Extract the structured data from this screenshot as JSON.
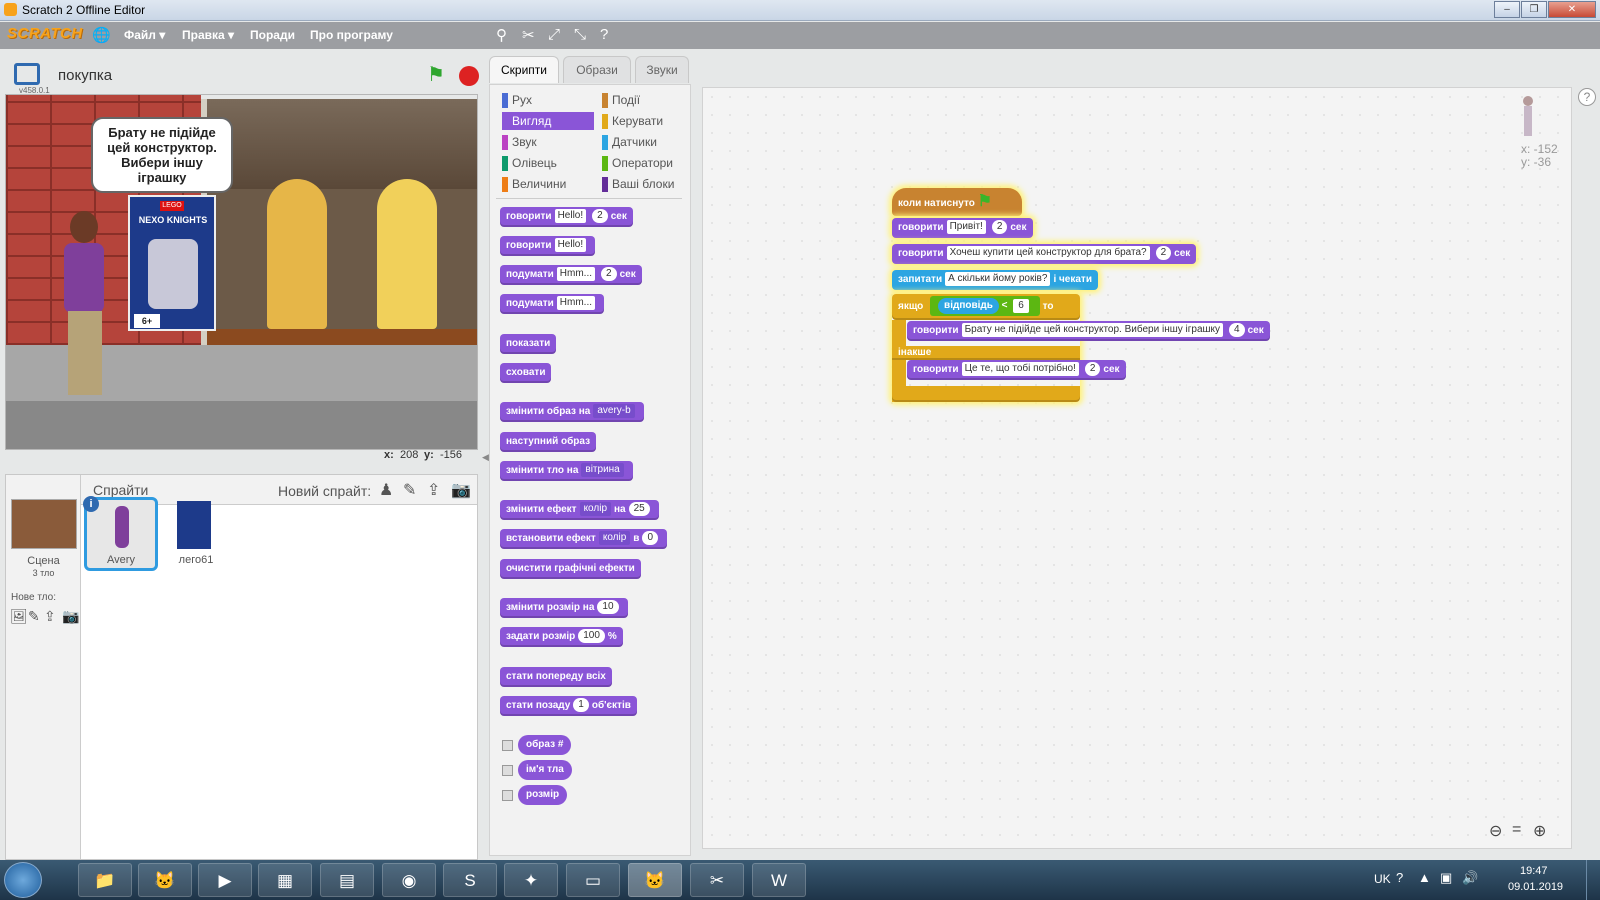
{
  "window": {
    "title": "Scratch 2 Offline Editor"
  },
  "menu": {
    "logo": "SCRATCH",
    "file": "Файл ▾",
    "edit": "Правка ▾",
    "tips": "Поради",
    "about": "Про програму"
  },
  "stage_header": {
    "project_name": "покупка",
    "version": "v458.0.1"
  },
  "stage": {
    "speech": "Брату не підійде цей конструктор. Вибери іншу іграшку",
    "box_brand": "LEGO",
    "box_title": "NEXO KNIGHTS",
    "box_age": "6+",
    "x_label": "x:",
    "x_value": "208",
    "y_label": "y:",
    "y_value": "-156"
  },
  "sprites_pane": {
    "title": "Спрайти",
    "new_sprite": "Новий спрайт:",
    "stage_label": "Сцена",
    "stage_backdrops": "3 тло",
    "new_backdrop": "Нове тло:",
    "sprites": [
      {
        "name": "Avery"
      },
      {
        "name": "лего61"
      }
    ]
  },
  "tabs": [
    "Скрипти",
    "Образи",
    "Звуки"
  ],
  "categories": [
    {
      "label": "Рух",
      "color": "#4a6cd4"
    },
    {
      "label": "Вигляд",
      "color": "#8a55d7"
    },
    {
      "label": "Звук",
      "color": "#bb42c3"
    },
    {
      "label": "Олівець",
      "color": "#0e9a6c"
    },
    {
      "label": "Величини",
      "color": "#ee7d16"
    },
    {
      "label": "Події",
      "color": "#c88330"
    },
    {
      "label": "Керувати",
      "color": "#e1a91a"
    },
    {
      "label": "Датчики",
      "color": "#2ca5e2"
    },
    {
      "label": "Оператори",
      "color": "#5cb712"
    },
    {
      "label": "Ваші блоки",
      "color": "#632d99"
    }
  ],
  "palette": {
    "say_secs": {
      "cmd": "говорити",
      "msg": "Hello!",
      "secs": "2",
      "unit": "сек"
    },
    "say": {
      "cmd": "говорити",
      "msg": "Hello!"
    },
    "think_secs": {
      "cmd": "подумати",
      "msg": "Hmm...",
      "secs": "2",
      "unit": "сек"
    },
    "think": {
      "cmd": "подумати",
      "msg": "Hmm..."
    },
    "show": "показати",
    "hide": "сховати",
    "switch_costume": {
      "cmd": "змінити образ на",
      "val": "avery-b"
    },
    "next_costume": "наступний образ",
    "switch_backdrop": {
      "cmd": "змінити тло на",
      "val": "вітрина"
    },
    "change_effect": {
      "cmd": "змінити ефект",
      "effect": "колір",
      "by": "на",
      "val": "25"
    },
    "set_effect": {
      "cmd": "встановити ефект",
      "effect": "колір",
      "to": "в",
      "val": "0"
    },
    "clear_effects": "очистити графічні ефекти",
    "change_size": {
      "cmd": "змінити розмір на",
      "val": "10"
    },
    "set_size": {
      "cmd": "задати розмір",
      "val": "100",
      "unit": "%"
    },
    "go_front": "стати попереду всіх",
    "go_back": {
      "cmd": "стати позаду",
      "val": "1",
      "unit": "об'єктів"
    },
    "reporters": [
      "образ #",
      "ім'я тла",
      "розмір"
    ]
  },
  "script": {
    "hat": "коли натиснуто",
    "say1": {
      "cmd": "говорити",
      "msg": "Привіт!",
      "secs": "2",
      "unit": "сек"
    },
    "say2": {
      "cmd": "говорити",
      "msg": "Хочеш купити цей конструктор для брата?",
      "secs": "2",
      "unit": "сек"
    },
    "ask": {
      "cmd": "запитати",
      "msg": "А скільки йому років?",
      "tail": "і чекати"
    },
    "if": {
      "kw": "якщо",
      "reporter": "відповідь",
      "op": "<",
      "val": "6",
      "then": "то"
    },
    "say3": {
      "cmd": "говорити",
      "msg": "Брату не підійде цей конструктор. Вибери іншу іграшку",
      "secs": "4",
      "unit": "сек"
    },
    "else": "інакше",
    "say4": {
      "cmd": "говорити",
      "msg": "Це те, що тобі потрібно!",
      "secs": "2",
      "unit": "сек"
    }
  },
  "sprite_info": {
    "x": "x: -152",
    "y": "y: -36"
  },
  "taskbar": {
    "lang": "UK",
    "time": "19:47",
    "date": "09.01.2019"
  }
}
